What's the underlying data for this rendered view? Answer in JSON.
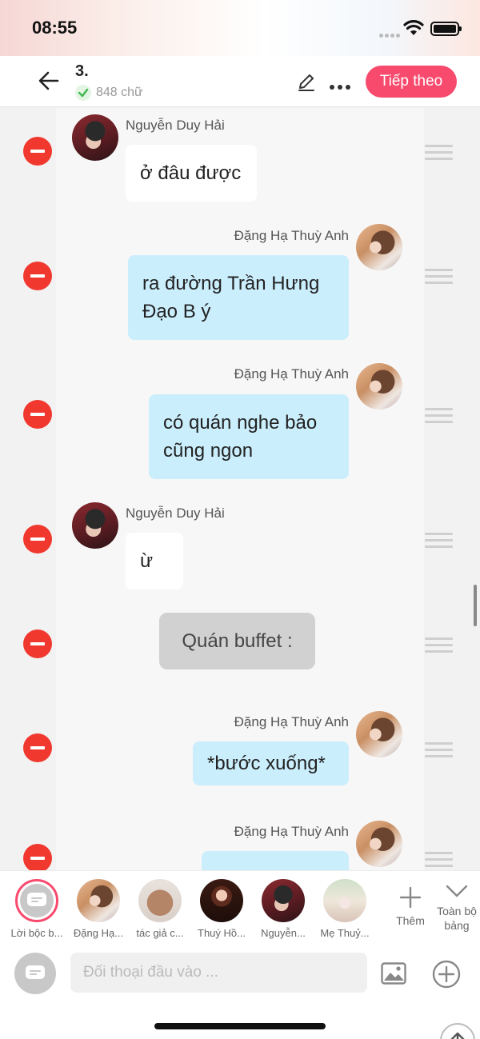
{
  "status": {
    "time": "08:55"
  },
  "header": {
    "chapter_title": "3.",
    "word_count": "848 chữ",
    "next_label": "Tiếp theo"
  },
  "messages": [
    {
      "type": "left",
      "sender": "Nguyễn Duy Hải",
      "text": "ở đâu được"
    },
    {
      "type": "right",
      "sender": "Đặng Hạ Thuỳ Anh",
      "text": "ra đường Trần Hưng Đạo B ý"
    },
    {
      "type": "right",
      "sender": "Đặng Hạ Thuỳ Anh",
      "text": "có quán nghe bảo cũng ngon"
    },
    {
      "type": "left",
      "sender": "Nguyễn Duy Hải",
      "text": "ừ"
    },
    {
      "type": "narration",
      "text": "Quán buffet :"
    },
    {
      "type": "right",
      "sender": "Đặng Hạ Thuỳ Anh",
      "text": "*bước xuống*"
    },
    {
      "type": "right",
      "sender": "Đặng Hạ Thuỳ Anh",
      "text": ""
    }
  ],
  "characters": [
    {
      "label": "Lời bộc b...",
      "icon": "narration-icon"
    },
    {
      "label": "Đặng Hạ...",
      "icon": "avatar"
    },
    {
      "label": "tác giả c...",
      "icon": "avatar"
    },
    {
      "label": "Thuý Hồ...",
      "icon": "avatar"
    },
    {
      "label": "Nguyễn...",
      "icon": "avatar"
    },
    {
      "label": "Mẹ Thuỷ...",
      "icon": "avatar"
    }
  ],
  "strip_actions": {
    "add_label": "Thêm",
    "all_label": "Toàn bộ bảng"
  },
  "input": {
    "placeholder": "Đối thoại đầu vào ..."
  },
  "colors": {
    "accent": "#f74a6d",
    "remove": "#f1382e",
    "right_bubble": "#cbeefd"
  }
}
